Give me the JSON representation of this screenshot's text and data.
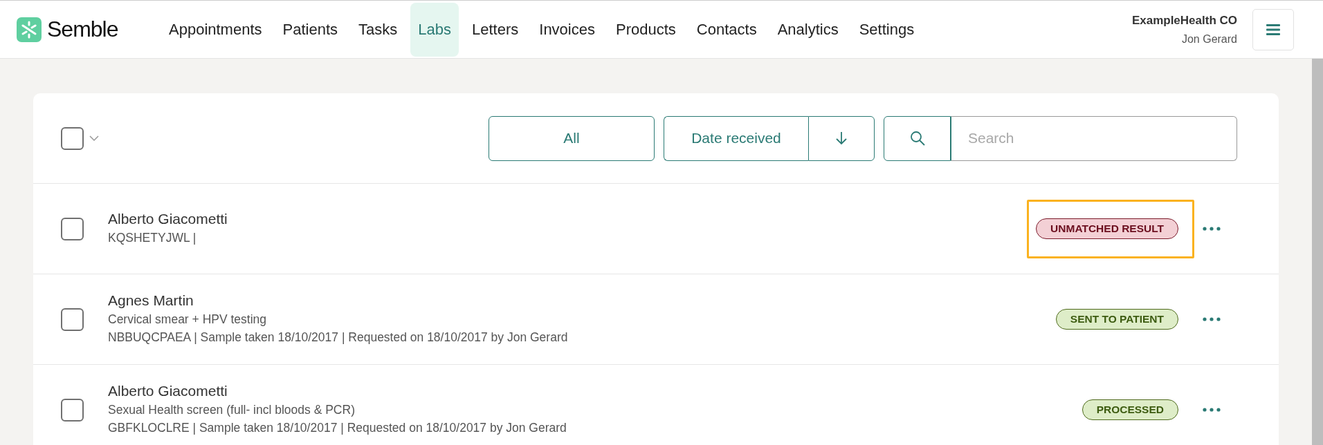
{
  "brand": {
    "name": "Semble"
  },
  "nav": [
    {
      "label": "Appointments",
      "selected": false
    },
    {
      "label": "Patients",
      "selected": false
    },
    {
      "label": "Tasks",
      "selected": false
    },
    {
      "label": "Labs",
      "selected": true
    },
    {
      "label": "Letters",
      "selected": false
    },
    {
      "label": "Invoices",
      "selected": false
    },
    {
      "label": "Products",
      "selected": false
    },
    {
      "label": "Contacts",
      "selected": false
    },
    {
      "label": "Analytics",
      "selected": false
    },
    {
      "label": "Settings",
      "selected": false
    }
  ],
  "account": {
    "organisation": "ExampleHealth CO",
    "user": "Jon Gerard"
  },
  "toolbar": {
    "select_all": {
      "checked": false
    },
    "filter": "All",
    "sort": "Date received",
    "search": {
      "placeholder": "Search"
    }
  },
  "results": [
    {
      "name": "Alberto Giacometti",
      "details": [
        "KQSHETYJWL |"
      ],
      "status": "UNMATCHED RESULT",
      "kind": "unmatched",
      "highlighted": true,
      "checked": false
    },
    {
      "name": "Agnes Martin",
      "details": [
        "Cervical smear + HPV testing",
        "NBBUQCPAEA | Sample taken 18/10/2017 | Requested on 18/10/2017 by Jon Gerard"
      ],
      "status": "SENT TO PATIENT",
      "kind": "done",
      "highlighted": false,
      "checked": false
    },
    {
      "name": "Alberto Giacometti",
      "details": [
        "Sexual Health screen (full- incl bloods & PCR)",
        "GBFKLOCLRE | Sample taken 18/10/2017 | Requested on 18/10/2017 by Jon Gerard"
      ],
      "status": "PROCESSED",
      "kind": "done",
      "highlighted": false,
      "checked": false
    }
  ]
}
